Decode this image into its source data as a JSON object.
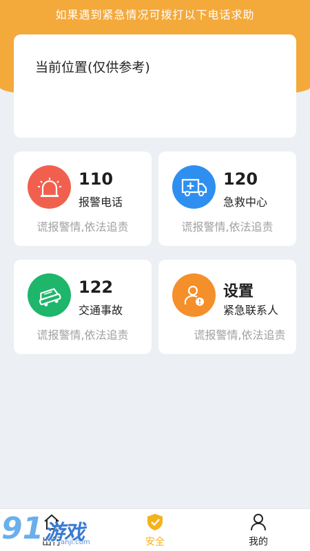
{
  "header": {
    "banner": "如果遇到紧急情况可拨打以下电话求助"
  },
  "location": {
    "title": "当前位置(仅供参考)"
  },
  "cards": [
    {
      "number": "110",
      "label": "报警电话",
      "note": "谎报警情,依法追责",
      "icon": "police-siren-icon",
      "color": "#f1604e"
    },
    {
      "number": "120",
      "label": "急救中心",
      "note": "谎报警情,依法追责",
      "icon": "ambulance-icon",
      "color": "#2f8ff0"
    },
    {
      "number": "122",
      "label": "交通事故",
      "note": "谎报警情,依法追责",
      "icon": "car-crash-icon",
      "color": "#1db66a"
    },
    {
      "number": "设置",
      "label": "紧急联系人",
      "note": "谎报警情,依法追责",
      "icon": "contact-alert-icon",
      "color": "#f58f2a"
    }
  ],
  "tabbar": {
    "items": [
      {
        "label": "出行",
        "icon": "home-icon"
      },
      {
        "label": "安全",
        "icon": "shield-check-icon",
        "active": true,
        "color": "#f4b21c"
      },
      {
        "label": "我的",
        "icon": "user-icon"
      }
    ]
  },
  "watermark": {
    "brand": "游戏",
    "digits": "91",
    "url": "anji.com"
  }
}
